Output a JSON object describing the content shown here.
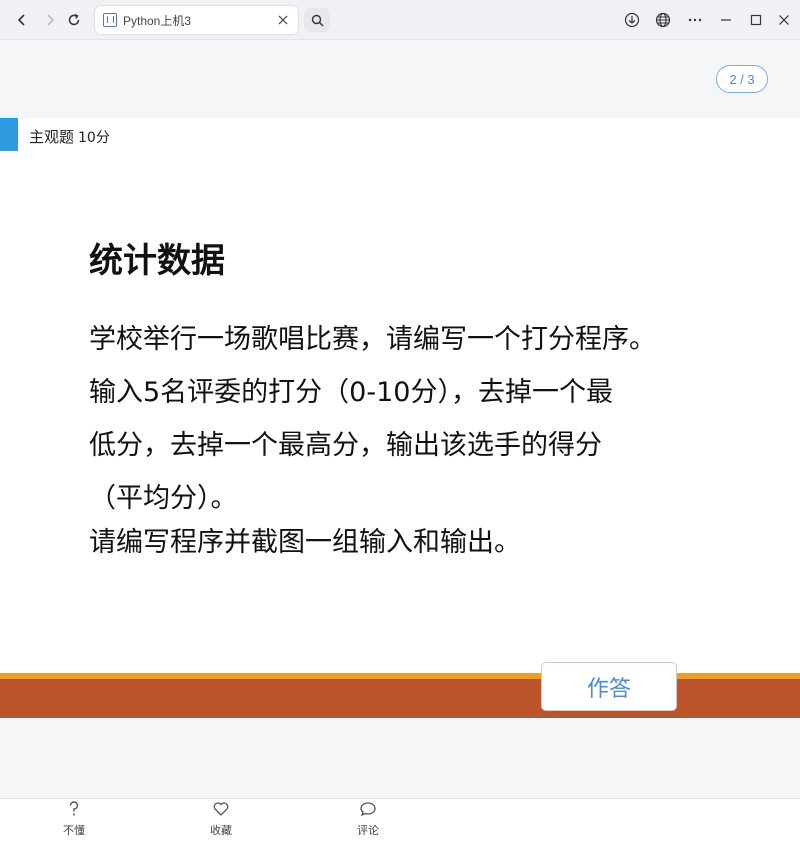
{
  "browser": {
    "tab_title": "Python上机3",
    "tab_close_icon": "close-icon",
    "back_icon": "chevron-left-icon",
    "forward_icon": "chevron-right-icon",
    "refresh_icon": "refresh-icon",
    "search_icon": "search-icon",
    "download_icon": "download-icon",
    "globe_icon": "globe-icon",
    "more_icon": "more-icon",
    "minimize_icon": "minimize-icon",
    "maximize_icon": "maximize-icon",
    "close_window_icon": "close-icon"
  },
  "pager": {
    "text": "2 / 3"
  },
  "question": {
    "type_label": "主观题",
    "score": "10分",
    "title": "统计数据",
    "body_lines": [
      "学校举行一场歌唱比赛，请编写一个打分程序。",
      "输入5名评委的打分（0-10分），去掉一个最",
      "低分，去掉一个最高分，输出该选手的得分",
      "（平均分）。"
    ],
    "subtext": "请编写程序并截图一组输入和输出。"
  },
  "answer_button": {
    "label": "作答"
  },
  "bottom_nav": [
    {
      "label": "不懂",
      "icon": "question-icon"
    },
    {
      "label": "收藏",
      "icon": "heart-icon"
    },
    {
      "label": "评论",
      "icon": "comment-icon"
    }
  ],
  "colors": {
    "accent_blue": "#2e9be0",
    "band_orange": "#bd552c",
    "band_stripe": "#e8a02c",
    "link_blue": "#4a8ad0"
  }
}
